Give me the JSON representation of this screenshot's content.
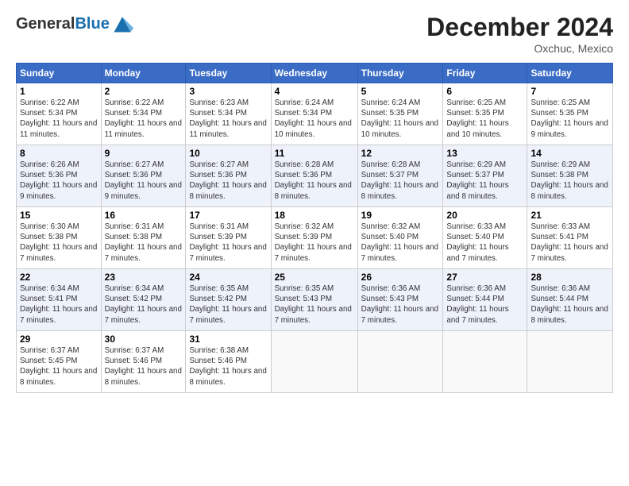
{
  "logo": {
    "general": "General",
    "blue": "Blue"
  },
  "header": {
    "month": "December 2024",
    "location": "Oxchuc, Mexico"
  },
  "days_of_week": [
    "Sunday",
    "Monday",
    "Tuesday",
    "Wednesday",
    "Thursday",
    "Friday",
    "Saturday"
  ],
  "weeks": [
    [
      {
        "day": "1",
        "sunrise": "6:22 AM",
        "sunset": "5:34 PM",
        "daylight": "11 hours and 11 minutes."
      },
      {
        "day": "2",
        "sunrise": "6:22 AM",
        "sunset": "5:34 PM",
        "daylight": "11 hours and 11 minutes."
      },
      {
        "day": "3",
        "sunrise": "6:23 AM",
        "sunset": "5:34 PM",
        "daylight": "11 hours and 11 minutes."
      },
      {
        "day": "4",
        "sunrise": "6:24 AM",
        "sunset": "5:34 PM",
        "daylight": "11 hours and 10 minutes."
      },
      {
        "day": "5",
        "sunrise": "6:24 AM",
        "sunset": "5:35 PM",
        "daylight": "11 hours and 10 minutes."
      },
      {
        "day": "6",
        "sunrise": "6:25 AM",
        "sunset": "5:35 PM",
        "daylight": "11 hours and 10 minutes."
      },
      {
        "day": "7",
        "sunrise": "6:25 AM",
        "sunset": "5:35 PM",
        "daylight": "11 hours and 9 minutes."
      }
    ],
    [
      {
        "day": "8",
        "sunrise": "6:26 AM",
        "sunset": "5:36 PM",
        "daylight": "11 hours and 9 minutes."
      },
      {
        "day": "9",
        "sunrise": "6:27 AM",
        "sunset": "5:36 PM",
        "daylight": "11 hours and 9 minutes."
      },
      {
        "day": "10",
        "sunrise": "6:27 AM",
        "sunset": "5:36 PM",
        "daylight": "11 hours and 8 minutes."
      },
      {
        "day": "11",
        "sunrise": "6:28 AM",
        "sunset": "5:36 PM",
        "daylight": "11 hours and 8 minutes."
      },
      {
        "day": "12",
        "sunrise": "6:28 AM",
        "sunset": "5:37 PM",
        "daylight": "11 hours and 8 minutes."
      },
      {
        "day": "13",
        "sunrise": "6:29 AM",
        "sunset": "5:37 PM",
        "daylight": "11 hours and 8 minutes."
      },
      {
        "day": "14",
        "sunrise": "6:29 AM",
        "sunset": "5:38 PM",
        "daylight": "11 hours and 8 minutes."
      }
    ],
    [
      {
        "day": "15",
        "sunrise": "6:30 AM",
        "sunset": "5:38 PM",
        "daylight": "11 hours and 7 minutes."
      },
      {
        "day": "16",
        "sunrise": "6:31 AM",
        "sunset": "5:38 PM",
        "daylight": "11 hours and 7 minutes."
      },
      {
        "day": "17",
        "sunrise": "6:31 AM",
        "sunset": "5:39 PM",
        "daylight": "11 hours and 7 minutes."
      },
      {
        "day": "18",
        "sunrise": "6:32 AM",
        "sunset": "5:39 PM",
        "daylight": "11 hours and 7 minutes."
      },
      {
        "day": "19",
        "sunrise": "6:32 AM",
        "sunset": "5:40 PM",
        "daylight": "11 hours and 7 minutes."
      },
      {
        "day": "20",
        "sunrise": "6:33 AM",
        "sunset": "5:40 PM",
        "daylight": "11 hours and 7 minutes."
      },
      {
        "day": "21",
        "sunrise": "6:33 AM",
        "sunset": "5:41 PM",
        "daylight": "11 hours and 7 minutes."
      }
    ],
    [
      {
        "day": "22",
        "sunrise": "6:34 AM",
        "sunset": "5:41 PM",
        "daylight": "11 hours and 7 minutes."
      },
      {
        "day": "23",
        "sunrise": "6:34 AM",
        "sunset": "5:42 PM",
        "daylight": "11 hours and 7 minutes."
      },
      {
        "day": "24",
        "sunrise": "6:35 AM",
        "sunset": "5:42 PM",
        "daylight": "11 hours and 7 minutes."
      },
      {
        "day": "25",
        "sunrise": "6:35 AM",
        "sunset": "5:43 PM",
        "daylight": "11 hours and 7 minutes."
      },
      {
        "day": "26",
        "sunrise": "6:36 AM",
        "sunset": "5:43 PM",
        "daylight": "11 hours and 7 minutes."
      },
      {
        "day": "27",
        "sunrise": "6:36 AM",
        "sunset": "5:44 PM",
        "daylight": "11 hours and 7 minutes."
      },
      {
        "day": "28",
        "sunrise": "6:36 AM",
        "sunset": "5:44 PM",
        "daylight": "11 hours and 8 minutes."
      }
    ],
    [
      {
        "day": "29",
        "sunrise": "6:37 AM",
        "sunset": "5:45 PM",
        "daylight": "11 hours and 8 minutes."
      },
      {
        "day": "30",
        "sunrise": "6:37 AM",
        "sunset": "5:46 PM",
        "daylight": "11 hours and 8 minutes."
      },
      {
        "day": "31",
        "sunrise": "6:38 AM",
        "sunset": "5:46 PM",
        "daylight": "11 hours and 8 minutes."
      },
      null,
      null,
      null,
      null
    ]
  ]
}
